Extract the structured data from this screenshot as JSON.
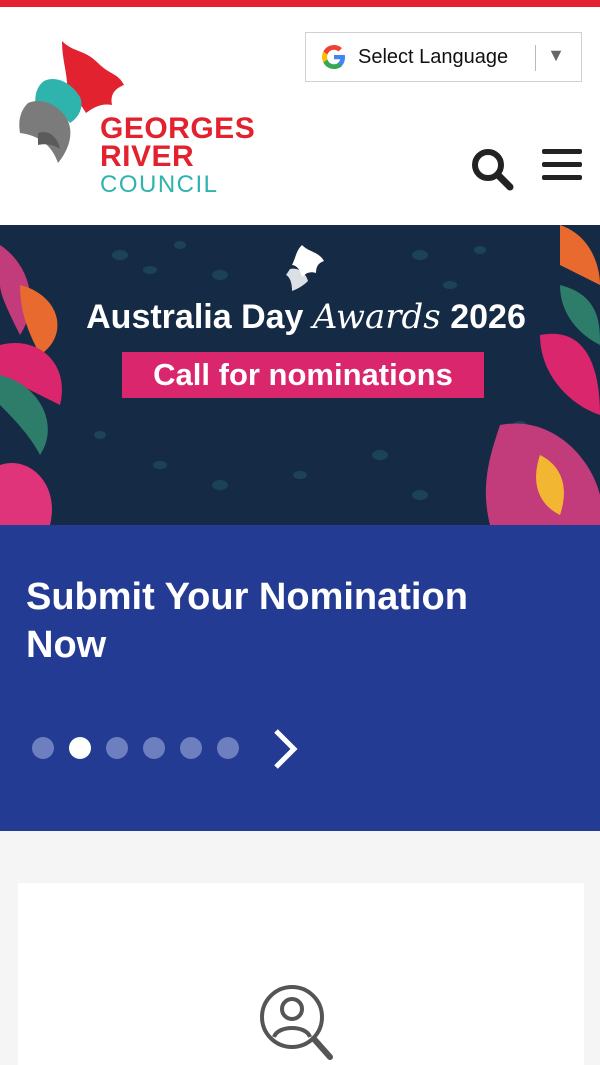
{
  "header": {
    "logo": {
      "line1": "GEORGES",
      "line2": "RIVER",
      "line3": "COUNCIL"
    },
    "language": {
      "label": "Select Language",
      "arrow": "▼",
      "icon": "google-g-icon"
    },
    "search_icon": "search-icon",
    "menu_icon": "hamburger-menu-icon"
  },
  "banner": {
    "title_start": "Australia Day ",
    "title_script": "Awards",
    "title_end": " 2026",
    "cta": "Call for nominations"
  },
  "slider": {
    "heading": "Submit Your Nomination Now",
    "dot_count": 6,
    "active_dot": 2,
    "next_icon": "chevron-right-icon"
  },
  "card": {
    "icon": "person-search-icon"
  },
  "colors": {
    "brand_red": "#e2232f",
    "brand_teal": "#2fb3ad",
    "slider_blue": "#243b93",
    "banner_navy": "#142a45",
    "cta_pink": "#d9266d"
  }
}
